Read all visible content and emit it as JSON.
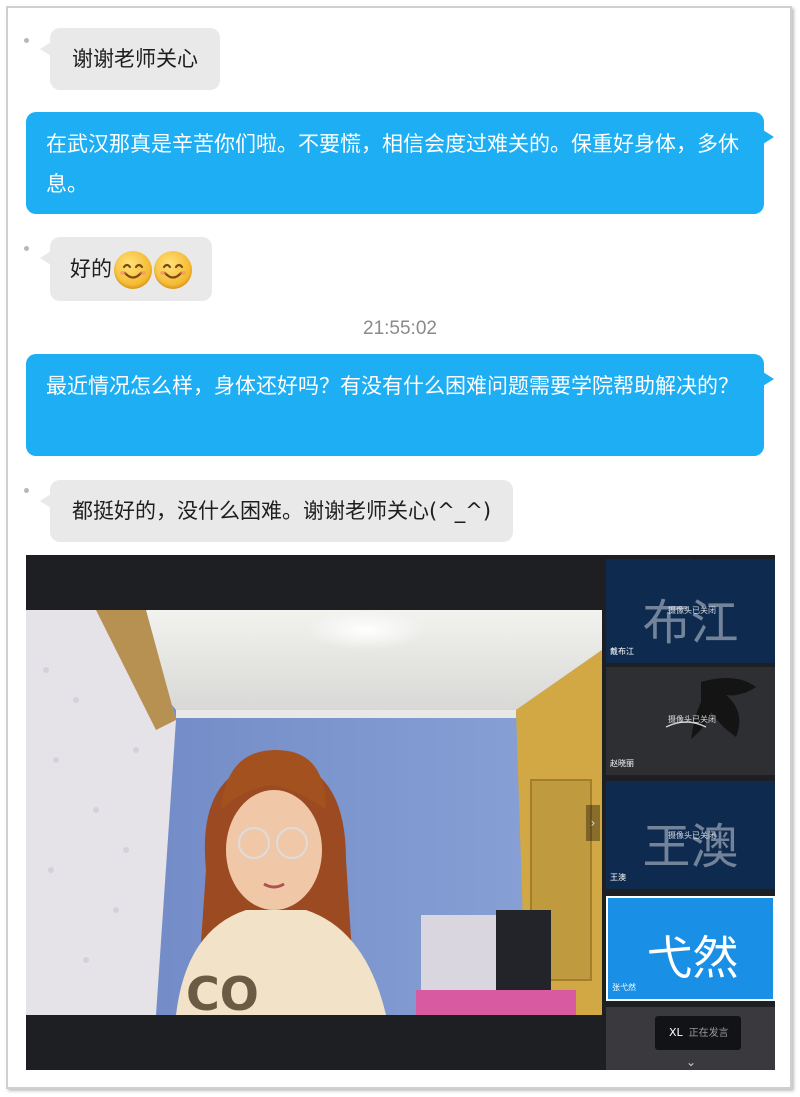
{
  "chat": {
    "messages": [
      {
        "side": "in",
        "text": "谢谢老师关心"
      },
      {
        "side": "out",
        "text": "在武汉那真是辛苦你们啦。不要慌，相信会度过难关的。保重好身体，多休息。"
      },
      {
        "side": "in",
        "text": "好的",
        "emoji": [
          "smiling-face-icon",
          "smiling-face-icon"
        ]
      },
      {
        "side": "out",
        "text": "最近情况怎么样，身体还好吗？有没有什么困难问题需要学院帮助解决的？"
      },
      {
        "side": "in",
        "text": "都挺好的，没什么困难。谢谢老师关心(^_^)"
      }
    ],
    "timestamp": "21:55:02"
  },
  "video_call": {
    "participants": [
      {
        "big_name": "布江",
        "label": "戴布江",
        "status": "摄像头已关闭",
        "bg": "#0e2a4f"
      },
      {
        "big_name": "",
        "label": "赵晓丽",
        "status": "摄像头已关闭",
        "bg": "#2e2f33"
      },
      {
        "big_name": "王澳",
        "label": "王澳",
        "status": "摄像头已关闭",
        "bg": "#0e2a4f"
      },
      {
        "big_name": "弋然",
        "label": "张弋然",
        "status": "",
        "bg": "#1a8fe6"
      }
    ],
    "speaking_badge": {
      "initials": "XL",
      "text": "正在发言"
    },
    "colors": {
      "bubble_out": "#1daef3",
      "bubble_in": "#e9e9e9",
      "video_bg": "#1d1f23"
    }
  }
}
